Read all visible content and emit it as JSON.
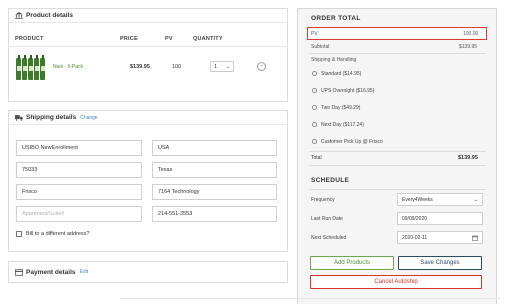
{
  "product_details": {
    "title": "Product details",
    "columns": [
      "PRODUCT",
      "PRICE",
      "PV",
      "QUANTITY"
    ],
    "item": {
      "name": "Nani - 5 Pack",
      "price": "$139.95",
      "pv": "100",
      "quantity": "1"
    }
  },
  "shipping_details": {
    "title": "Shipping details",
    "change_link": "Change",
    "fields": {
      "first_name": "USIBO NewEnrollment",
      "country": "USA",
      "zip": "75033",
      "state": "Texas",
      "city": "Frisco",
      "address": "7164 Technology",
      "apartment_placeholder": "Apartment/Suite#",
      "phone": "214-551-3553"
    },
    "bill_to_different": "Bill to a different address?"
  },
  "payment_details": {
    "title": "Payment details",
    "edit_link": "Edit"
  },
  "order_total": {
    "title": "ORDER TOTAL",
    "pv_label": "PV",
    "pv_value": "100.00",
    "subtotal_label": "Subtotal",
    "subtotal_value": "$139.95",
    "shipping_label": "Shipping & Handling",
    "shipping_options": [
      "Standard ($14.95)",
      "UPS Overnight ($16.95)",
      "Two Day ($49.29)",
      "Next Day ($117.24)",
      "Customer Pick Up @ Frisco"
    ],
    "total_label": "Total",
    "total_value": "$139.95"
  },
  "schedule": {
    "title": "SCHEDULE",
    "frequency_label": "Frequency",
    "frequency_value": "Every4Weeks",
    "last_run_label": "Last Run Date",
    "last_run_value": "09/09/2020",
    "next_label": "Next Scheduled",
    "next_value": "2020-02-11"
  },
  "buttons": {
    "add_products": "Add Products",
    "save_changes": "Save Changes",
    "cancel_autoship": "Cancel Autoship"
  },
  "colors": {
    "highlight_red": "#e03b2f",
    "add_green": "#4b8c2e",
    "save_navy": "#2e4a6b",
    "cancel_red": "#d9342b"
  }
}
